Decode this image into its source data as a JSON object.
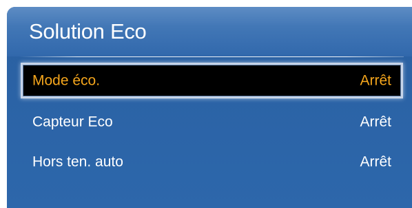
{
  "panel": {
    "title": "Solution Eco"
  },
  "menu": {
    "items": [
      {
        "label": "Mode éco.",
        "value": "Arrêt",
        "selected": true
      },
      {
        "label": "Capteur Eco",
        "value": "Arrêt",
        "selected": false
      },
      {
        "label": "Hors ten. auto",
        "value": "Arrêt",
        "selected": false
      }
    ]
  },
  "colors": {
    "panel_background": "#2b63a6",
    "header_background": "#4277b6",
    "selected_background": "#000000",
    "selected_text": "#f4a51c",
    "text": "#ffffff"
  }
}
